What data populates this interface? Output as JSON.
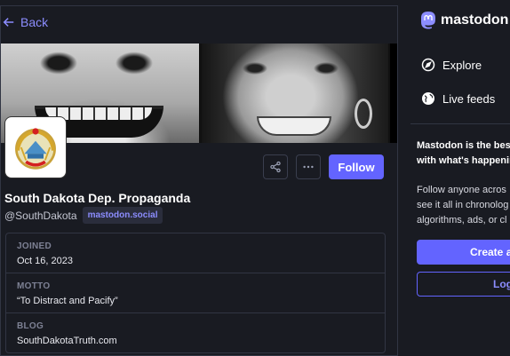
{
  "back_label": "Back",
  "profile": {
    "display_name": "South Dakota Dep. Propaganda",
    "handle": "@SouthDakota",
    "domain": "mastodon.social",
    "follow_label": "Follow"
  },
  "fields": [
    {
      "label": "JOINED",
      "value": "Oct 16, 2023"
    },
    {
      "label": "MOTTO",
      "value": "“To Distract and Pacify”"
    },
    {
      "label": "BLOG",
      "value": "SouthDakotaTruth.com"
    }
  ],
  "sidebar": {
    "brand": "mastodon",
    "nav": [
      {
        "label": "Explore",
        "icon": "compass-icon"
      },
      {
        "label": "Live feeds",
        "icon": "globe-icon"
      }
    ],
    "promo_bold_lines": [
      "Mastodon is the best",
      "with what's happenin"
    ],
    "promo_lines": [
      "Follow anyone acros",
      "see it all in chronolog",
      "algorithms, ads, or cl"
    ],
    "create_label": "Create a",
    "login_label": "Log"
  },
  "colors": {
    "accent": "#6364ff",
    "background": "#191b22",
    "link": "#8c8dff"
  }
}
